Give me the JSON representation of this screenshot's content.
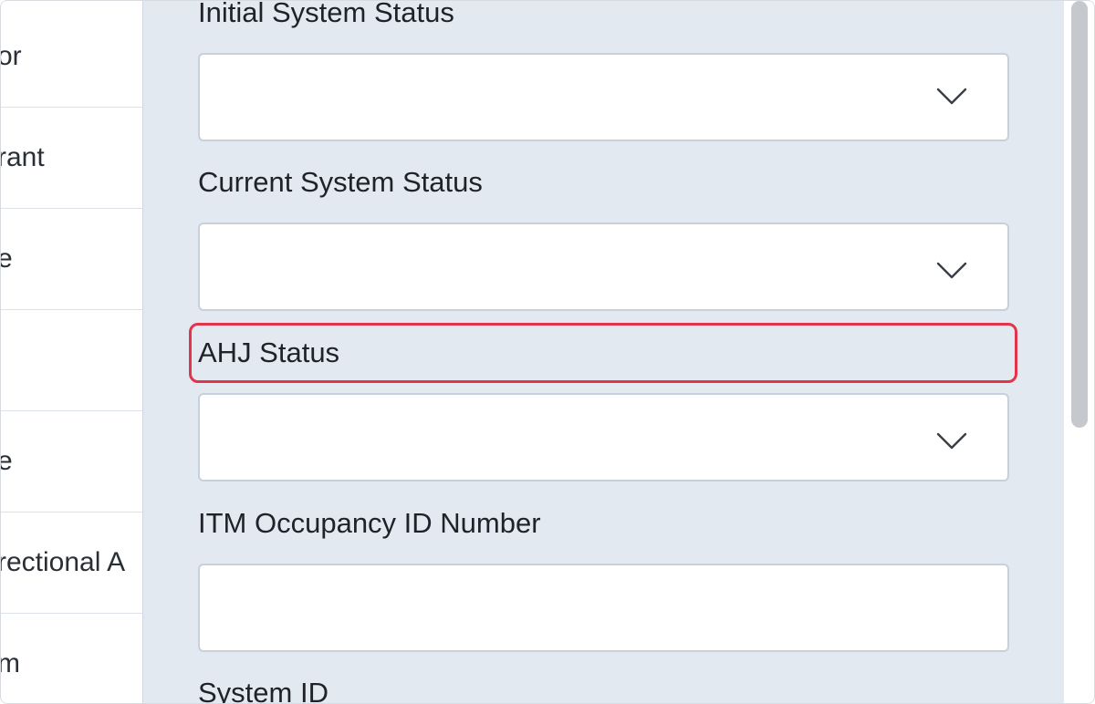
{
  "left_list": {
    "items": [
      {
        "label": "or"
      },
      {
        "label": "rant"
      },
      {
        "label": "e"
      },
      {
        "label": ""
      },
      {
        "label": "e"
      },
      {
        "label": "rectional A"
      },
      {
        "label": "m"
      }
    ]
  },
  "form": {
    "fields": [
      {
        "label": "Initial System Status",
        "type": "select",
        "value": ""
      },
      {
        "label": "Current System Status",
        "type": "select",
        "value": ""
      },
      {
        "label": "AHJ Status",
        "type": "select",
        "value": ""
      },
      {
        "label": "ITM Occupancy ID Number",
        "type": "text",
        "value": ""
      },
      {
        "label": "System ID",
        "type": "text",
        "value": ""
      }
    ]
  },
  "icons": {
    "dropdown": "chevron-down-icon"
  },
  "colors": {
    "panel_bg": "#e3e9f1",
    "highlight": "#e2344a",
    "input_border": "#c9d0d9"
  }
}
